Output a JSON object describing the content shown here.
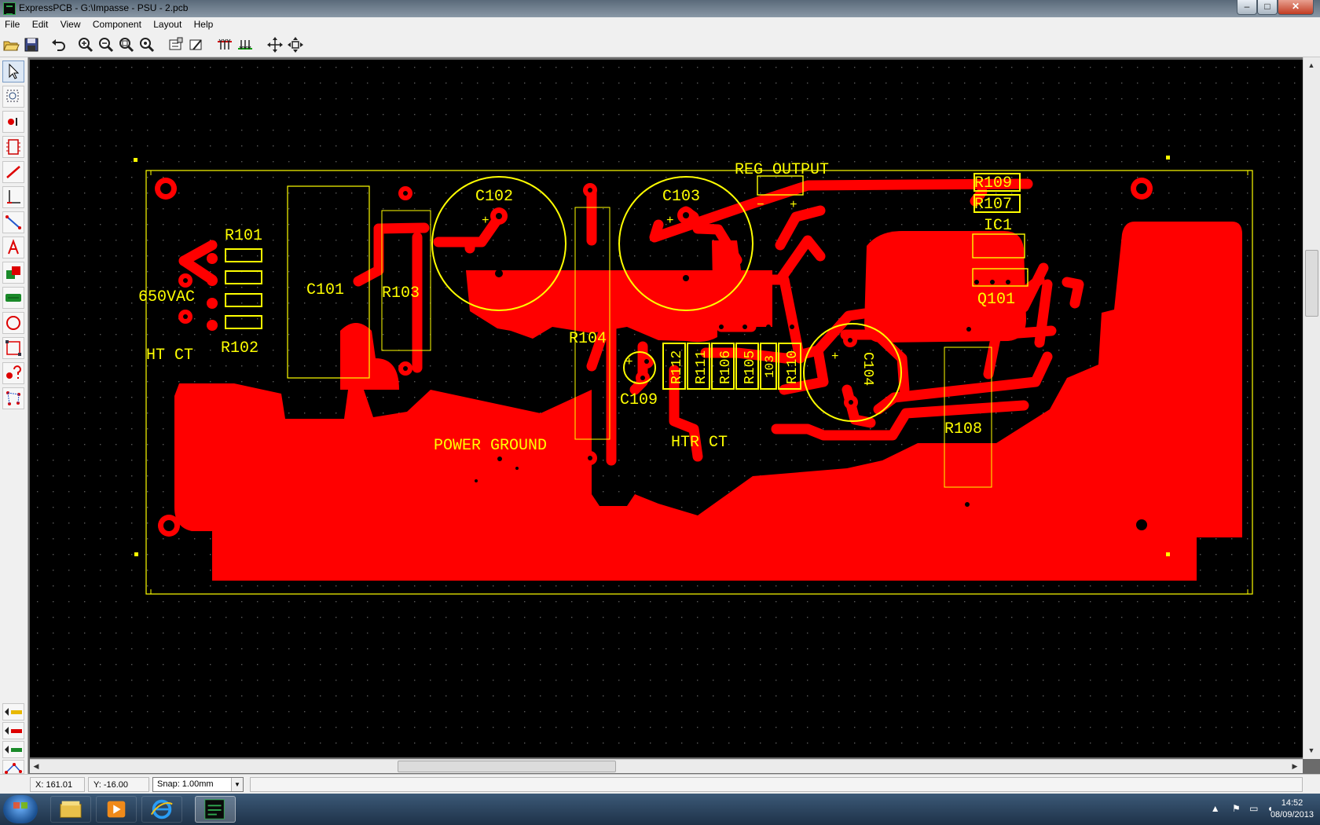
{
  "window": {
    "title": "ExpressPCB - G:\\Impasse - PSU - 2.pcb",
    "minimize_label": "–",
    "maximize_label": "□",
    "close_label": "✕"
  },
  "menu": [
    "File",
    "Edit",
    "View",
    "Component",
    "Layout",
    "Help"
  ],
  "toolbar": {
    "buttons": [
      "open-icon",
      "save-icon",
      "undo-icon",
      "zoom-in-icon",
      "zoom-out-icon",
      "zoom-fit-icon",
      "zoom-area-icon",
      "component-properties-icon",
      "part-editor-icon",
      "top-layer-icon",
      "bottom-layer-icon",
      "pan-icon",
      "center-icon"
    ]
  },
  "left_tools": [
    "select-icon",
    "zoom-box-icon",
    "place-pad-icon",
    "place-component-icon",
    "trace-icon",
    "corner-trace-icon",
    "rats-nest-icon",
    "text-icon",
    "filled-plane-icon",
    "ground-plane-icon",
    "circle-icon",
    "rectangle-icon",
    "query-icon",
    "netlist-icon"
  ],
  "layer_toggles": [
    "top-layer-toggle-icon",
    "bottom-layer-toggle-icon",
    "silkscreen-toggle-icon",
    "ratsnest-toggle-icon"
  ],
  "board": {
    "labels": {
      "r101": "R101",
      "r102": "R102",
      "vac": "650VAC",
      "htct": "HT CT",
      "c101": "C101",
      "r103": "R103",
      "c102": "C102",
      "c103": "C103",
      "r104": "R104",
      "reg_output": "REG OUTPUT",
      "r109": "R109",
      "r107": "R107",
      "ic1": "IC1",
      "q101": "Q101",
      "c109": "C109",
      "r112": "R112",
      "r111": "R111",
      "r106": "R106",
      "r105": "R105",
      "r103b": "103",
      "r110": "R110",
      "c104": "C104",
      "power_ground": "POWER GROUND",
      "htr_ct": "HTR CT",
      "r108": "R108",
      "plus": "+",
      "minus": "−"
    },
    "colors": {
      "copper": "#ff0000",
      "silk": "#ffff00",
      "background": "#000000",
      "grid": "#5a5a5a"
    }
  },
  "status": {
    "x": "X: 161.01",
    "y": "Y: -16.00",
    "snap": "Snap:  1.00mm"
  },
  "taskbar": {
    "apps": [
      "explorer-icon",
      "media-player-icon",
      "internet-explorer-icon",
      "expresspcb-icon"
    ],
    "time": "14:52",
    "date": "08/09/2013"
  }
}
